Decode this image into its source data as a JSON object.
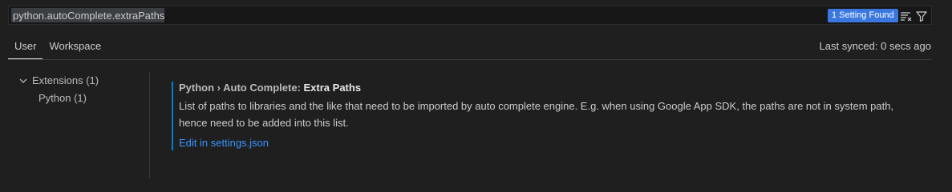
{
  "search": {
    "value": "python.autoComplete.extraPaths",
    "result_count": "1 Setting Found"
  },
  "icons": {
    "clear_filter": "clear-filter-icon",
    "filter": "filter-icon",
    "chevron": "chevron-down-icon"
  },
  "tabs": [
    {
      "label": "User",
      "active": true
    },
    {
      "label": "Workspace",
      "active": false
    }
  ],
  "sync_status": "Last synced: 0 secs ago",
  "toc": {
    "items": [
      {
        "label": "Extensions (1)",
        "expanded": true
      },
      {
        "label": "Python (1)"
      }
    ]
  },
  "setting": {
    "category": "Python › Auto Complete: ",
    "name": "Extra Paths",
    "description": "List of paths to libraries and the like that need to be imported by auto complete engine. E.g. when using Google App SDK, the paths are not in system path, hence need to be added into this list.",
    "link": "Edit in settings.json"
  },
  "colors": {
    "background": "#1f1f1f",
    "accent": "#007fd4",
    "badge": "#3a78e0",
    "link": "#3794ff"
  }
}
